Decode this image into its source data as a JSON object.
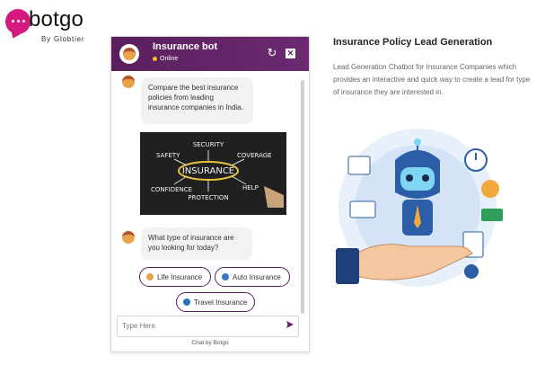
{
  "brand": {
    "name": "botgo",
    "tagline": "By Globtier",
    "color": "#d6197f"
  },
  "chat": {
    "title": "Insurance bot",
    "status": "Online",
    "header_color": "#5a1f5f",
    "messages": [
      {
        "text": "Compare the best insurance policies from leading insurance companies in India."
      },
      {
        "text": "What type of insurance are you looking for today?"
      }
    ],
    "image_words": {
      "center": "INSURANCE",
      "top": "SECURITY",
      "left_top": "SAFETY",
      "right_top": "COVERAGE",
      "left_bottom": "CONFIDENCE",
      "bottom": "PROTECTION",
      "right_bottom": "HELP"
    },
    "options": [
      {
        "label": "Life Insurance",
        "icon": "person-icon"
      },
      {
        "label": "Auto Insurance",
        "icon": "car-icon"
      },
      {
        "label": "Travel Insurance",
        "icon": "globe-icon"
      }
    ],
    "input_placeholder": "Type Here",
    "footer": "Chat by Botgo"
  },
  "content": {
    "title": "Insurance Policy Lead Generation",
    "description": "Lead Generation Chatbot for Insurance Companies which provides an interactive and quick way to create a lead for type of insurance they are interested in."
  }
}
